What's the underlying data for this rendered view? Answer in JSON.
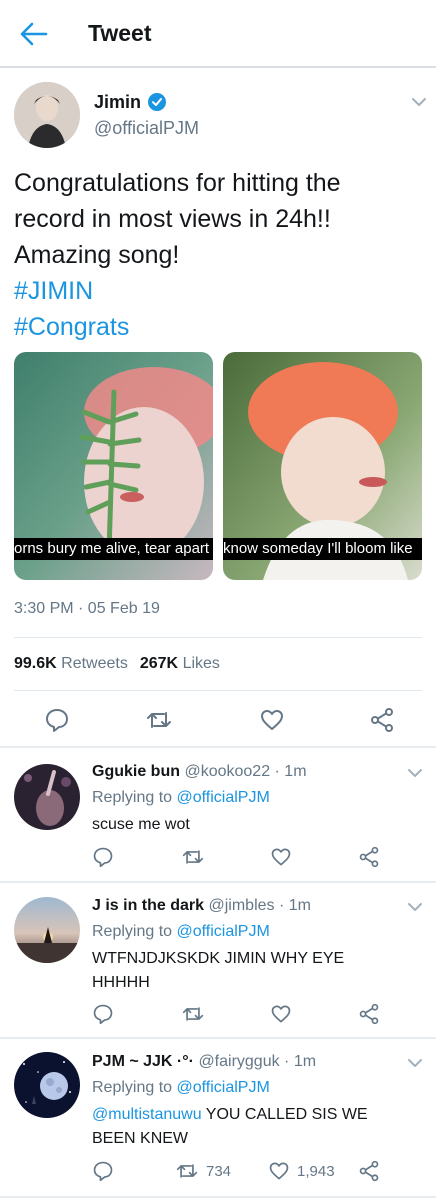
{
  "header": {
    "title": "Tweet"
  },
  "tweet": {
    "author_name": "Jimin",
    "author_handle": "@officialPJM",
    "text_lines": [
      "Congratulations for hitting the",
      "record in most views in 24h!!",
      "Amazing song!"
    ],
    "hashtags": [
      "#JIMIN",
      "#Congrats"
    ],
    "media_captions": [
      "orns bury me alive, tear apart",
      "know someday I'll bloom like"
    ],
    "timestamp": "3:30 PM · 05 Feb 19",
    "retweets_count": "99.6K",
    "retweets_label": "Retweets",
    "likes_count": "267K",
    "likes_label": "Likes"
  },
  "replies": [
    {
      "name": "Ggukie bun",
      "handle": "@kookoo22 · 1m",
      "replying_label": "Replying to",
      "replying_to": "@officialPJM",
      "text": "scuse me wot"
    },
    {
      "name": "J is in the dark",
      "handle": "@jimbles · 1m",
      "replying_label": "Replying to",
      "replying_to": "@officialPJM",
      "text": "WTFNJDJKSKDK JIMIN WHY EYE HHHHH"
    },
    {
      "name": "PJM ~ JJK ·°·",
      "handle": "@fairygguk · 1m",
      "replying_label": "Replying to",
      "replying_to": "@officialPJM",
      "mention": "@multistanuwu",
      "text": "YOU CALLED SIS WE BEEN KNEW",
      "retweet_count": "734",
      "like_count": "1,943"
    }
  ],
  "colors": {
    "accent": "#1b95e0",
    "muted": "#657786",
    "text": "#14171a",
    "divider": "#e1e8ed"
  },
  "icons": [
    "back-arrow-icon",
    "verified-badge-icon",
    "chevron-down-icon",
    "reply-icon",
    "retweet-icon",
    "like-icon",
    "share-icon"
  ]
}
